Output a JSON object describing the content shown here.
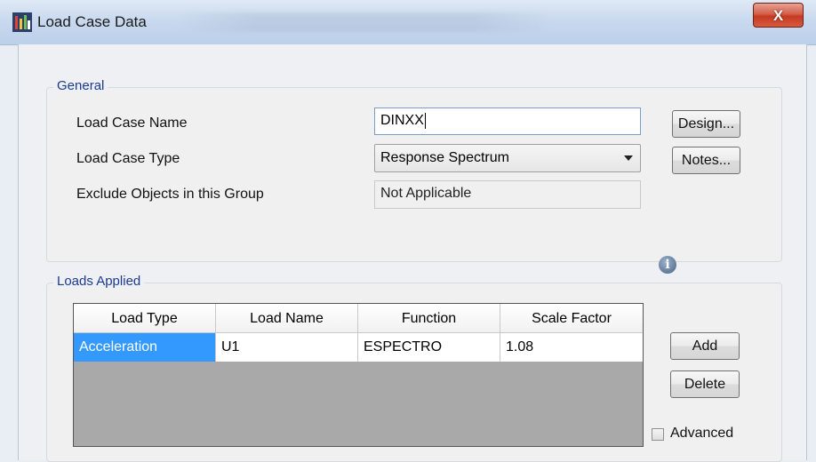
{
  "window": {
    "title": "Load Case Data",
    "close_glyph": "X"
  },
  "general": {
    "legend": "General",
    "load_case_name_label": "Load Case Name",
    "load_case_name_value": "DINXX",
    "load_case_type_label": "Load Case Type",
    "load_case_type_value": "Response Spectrum",
    "exclude_objects_label": "Exclude Objects in this Group",
    "exclude_objects_value": "Not Applicable",
    "design_button": "Design...",
    "notes_button": "Notes..."
  },
  "loads_applied": {
    "legend": "Loads Applied",
    "columns": [
      "Load Type",
      "Load Name",
      "Function",
      "Scale Factor"
    ],
    "rows": [
      [
        "Acceleration",
        "U1",
        "ESPECTRO",
        "1.08"
      ]
    ],
    "add_button": "Add",
    "delete_button": "Delete",
    "advanced_label": "Advanced",
    "advanced_checked": false,
    "info_glyph": "i"
  },
  "colors": {
    "selection": "#3399ff",
    "close_button": "#c23b22",
    "group_legend": "#1a3a8f"
  }
}
